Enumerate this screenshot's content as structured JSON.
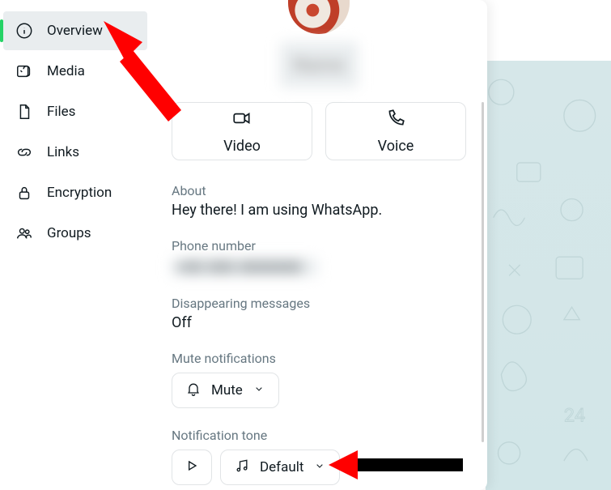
{
  "sidebar": {
    "items": [
      {
        "label": "Overview",
        "icon": "info-icon",
        "active": true
      },
      {
        "label": "Media",
        "icon": "media-icon",
        "active": false
      },
      {
        "label": "Files",
        "icon": "file-icon",
        "active": false
      },
      {
        "label": "Links",
        "icon": "link-icon",
        "active": false
      },
      {
        "label": "Encryption",
        "icon": "lock-icon",
        "active": false
      },
      {
        "label": "Groups",
        "icon": "groups-icon",
        "active": false
      }
    ]
  },
  "contact": {
    "name": "Name",
    "about_label": "About",
    "about_value": "Hey there! I am using WhatsApp.",
    "phone_label": "Phone number",
    "phone_value": "+00 000 0000000",
    "disappearing_label": "Disappearing messages",
    "disappearing_value": "Off",
    "mute_label": "Mute notifications",
    "mute_button": "Mute",
    "tone_label": "Notification tone",
    "tone_value": "Default"
  },
  "actions": {
    "video_label": "Video",
    "voice_label": "Voice"
  }
}
